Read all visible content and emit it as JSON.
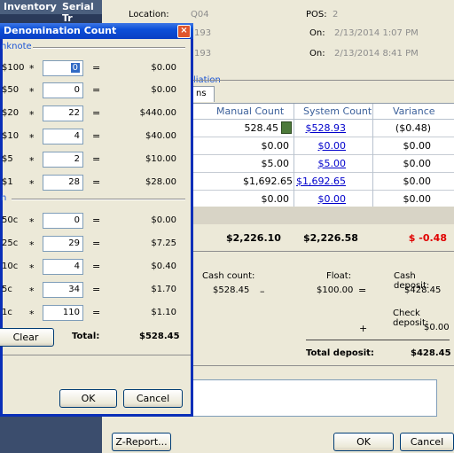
{
  "topnav": {
    "inventory": "Inventory",
    "serial": "Serial Tr"
  },
  "header": {
    "location_label": "Location:",
    "location_value": "Q04",
    "pos_label": "POS:",
    "pos_value": "2",
    "on1_label": "On:",
    "on1_value": "2/13/2014 1:07 PM",
    "on2_label": "On:",
    "on2_value": "2/13/2014 8:41 PM",
    "partial1": "193",
    "partial2": "193"
  },
  "tabs": {
    "reconciliation": "liation",
    "tab2": "ns"
  },
  "grid": {
    "columns": [
      "Manual Count",
      "System Count",
      "Variance"
    ],
    "rows": [
      {
        "manual": "528.45",
        "system": "$528.93",
        "variance": "($0.48)"
      },
      {
        "manual": "$0.00",
        "system": "$0.00",
        "variance": "$0.00"
      },
      {
        "manual": "$5.00",
        "system": "$5.00",
        "variance": "$0.00"
      },
      {
        "manual": "$1,692.65",
        "system": "$1,692.65",
        "variance": "$0.00"
      },
      {
        "manual": "$0.00",
        "system": "$0.00",
        "variance": "$0.00"
      }
    ],
    "totals": {
      "manual": "$2,226.10",
      "system": "$2,226.58",
      "variance": "$ -0.48"
    }
  },
  "summary": {
    "cash_count_label": "Cash count:",
    "cash_count_value": "$528.45",
    "minus": "–",
    "float_label": "Float:",
    "float_value": "$100.00",
    "equals": "=",
    "cash_deposit_label": "Cash deposit:",
    "cash_deposit_value": "$428.45",
    "check_deposit_label": "Check deposit:",
    "check_deposit_value": "$0.00",
    "plus": "+",
    "total_deposit_label": "Total deposit:",
    "total_deposit_value": "$428.45"
  },
  "bottom": {
    "zreport": "Z-Report...",
    "ok": "OK",
    "cancel": "Cancel"
  },
  "dialog": {
    "title": "Denomination Count",
    "banknote_label": "nknote",
    "coin_label": "n",
    "banknotes": [
      {
        "den": "$100",
        "qty": "0",
        "amt": "$0.00"
      },
      {
        "den": "$50",
        "qty": "0",
        "amt": "$0.00"
      },
      {
        "den": "$20",
        "qty": "22",
        "amt": "$440.00"
      },
      {
        "den": "$10",
        "qty": "4",
        "amt": "$40.00"
      },
      {
        "den": "$5",
        "qty": "2",
        "amt": "$10.00"
      },
      {
        "den": "$1",
        "qty": "28",
        "amt": "$28.00"
      }
    ],
    "coins": [
      {
        "den": "50c",
        "qty": "0",
        "amt": "$0.00"
      },
      {
        "den": "25c",
        "qty": "29",
        "amt": "$7.25"
      },
      {
        "den": "10c",
        "qty": "4",
        "amt": "$0.40"
      },
      {
        "den": "5c",
        "qty": "34",
        "amt": "$1.70"
      },
      {
        "den": "1c",
        "qty": "110",
        "amt": "$1.10"
      }
    ],
    "clear": "Clear",
    "total_label": "Total:",
    "total_value": "$528.45",
    "ok": "OK",
    "cancel": "Cancel",
    "star": "*",
    "eq": "="
  }
}
